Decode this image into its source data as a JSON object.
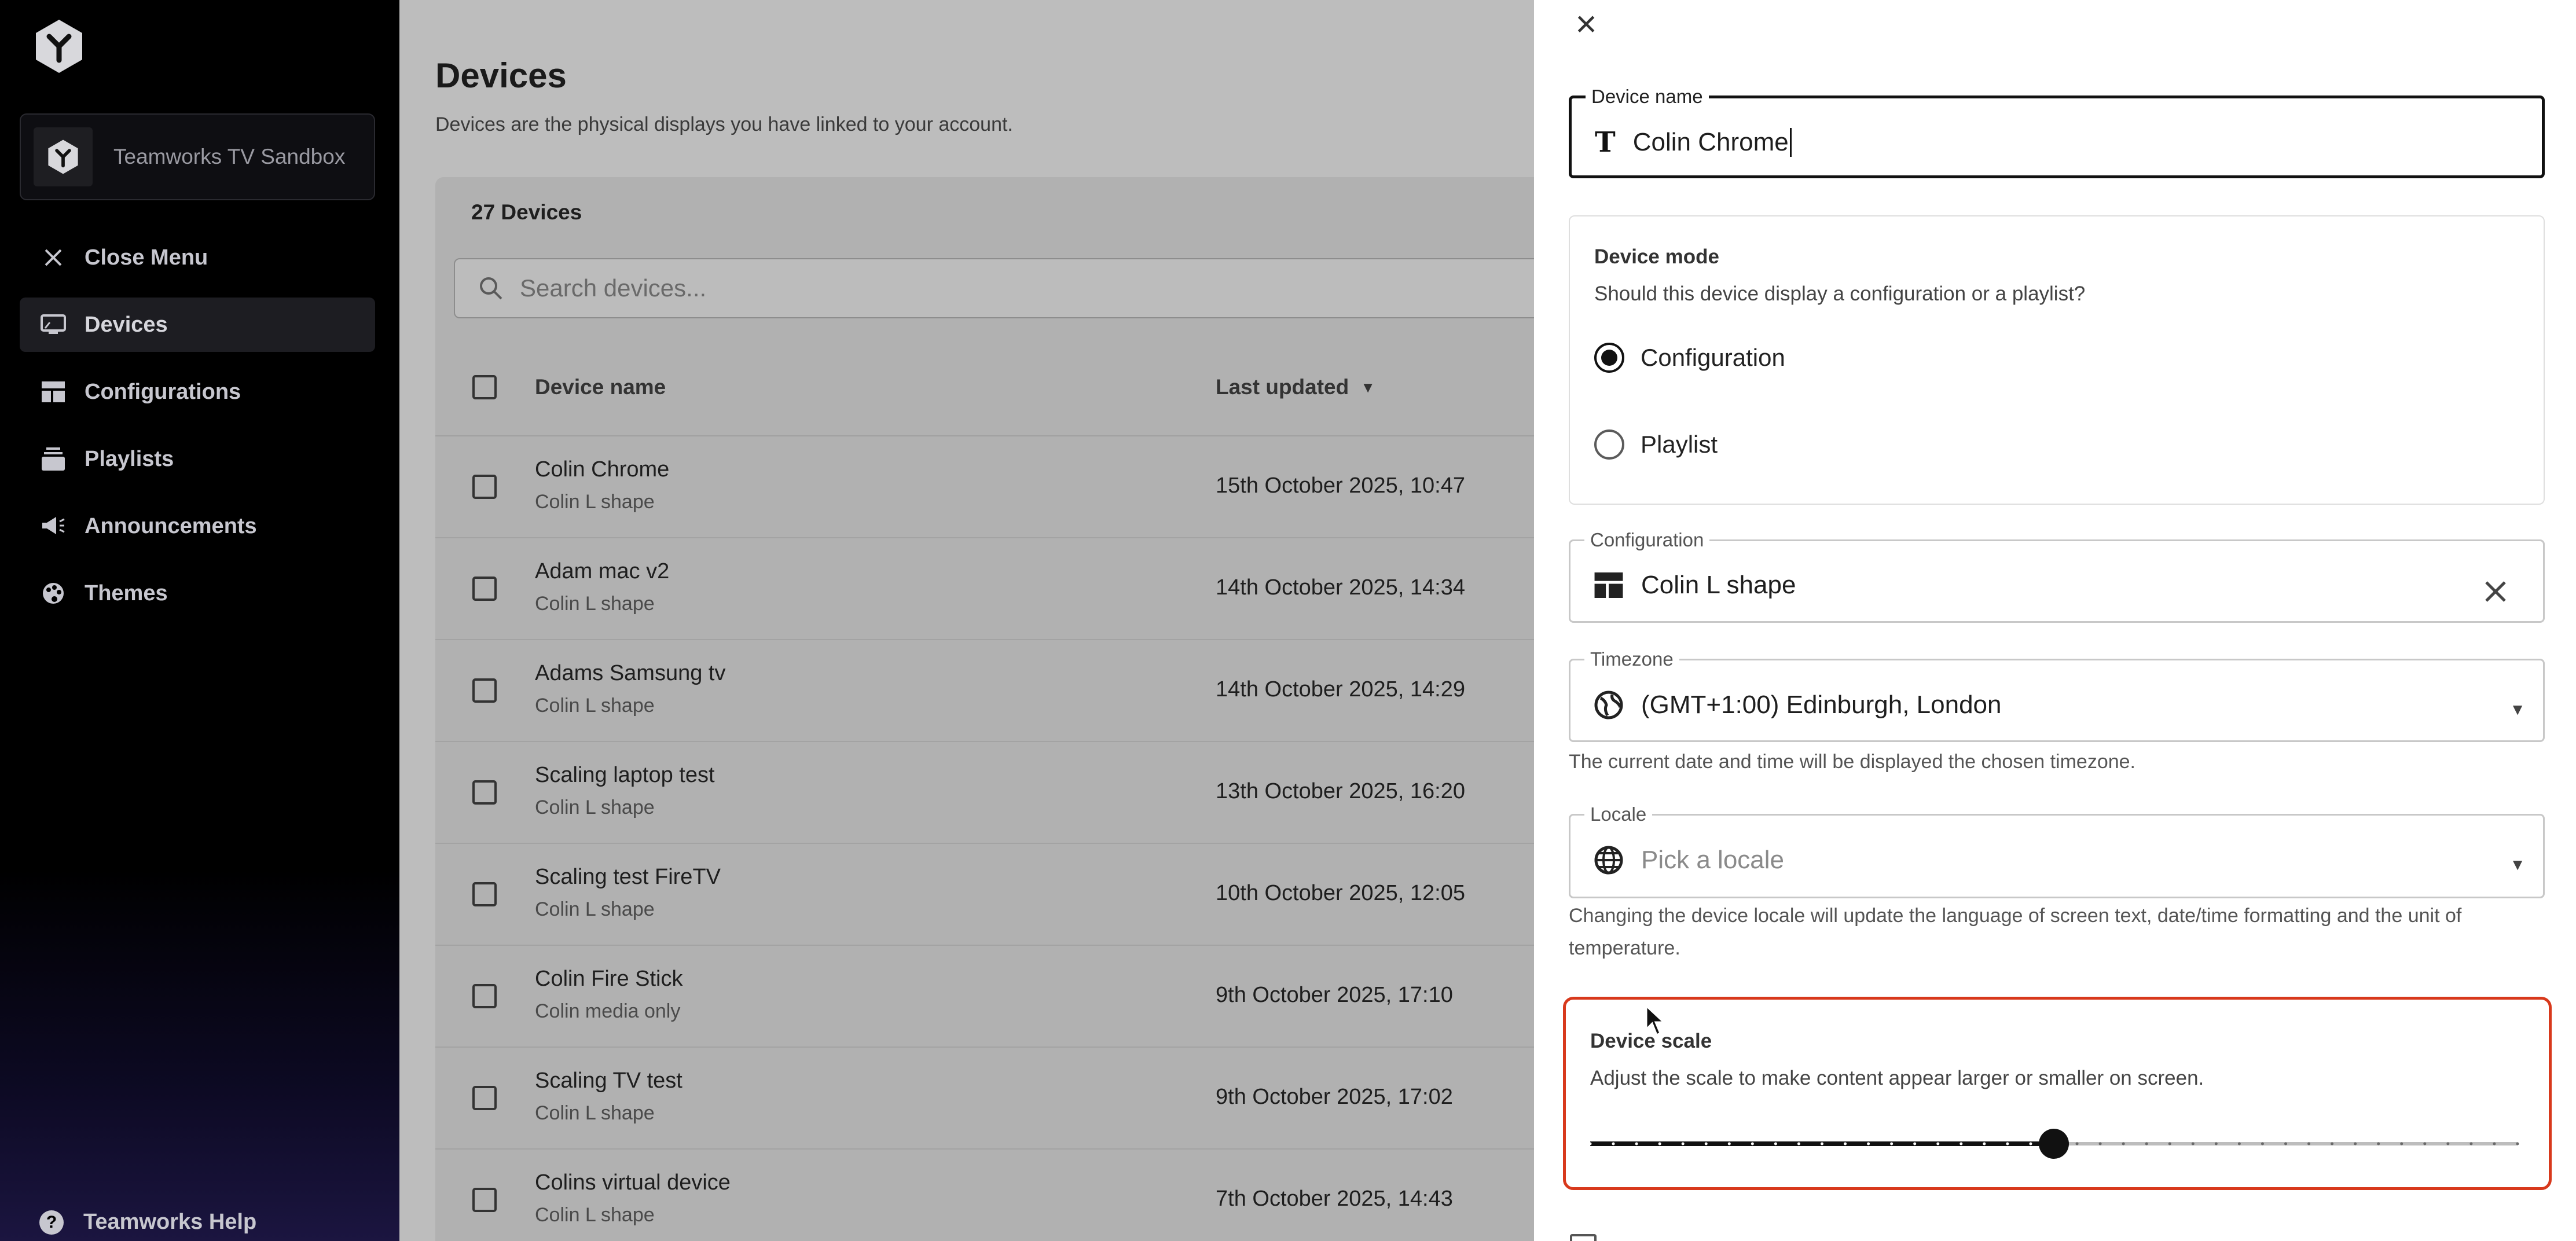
{
  "sidebar": {
    "org_name": "Teamworks TV Sandbox",
    "items": [
      {
        "label": "Close Menu",
        "icon": "close-icon"
      },
      {
        "label": "Devices",
        "icon": "monitor-icon",
        "active": true
      },
      {
        "label": "Configurations",
        "icon": "layout-icon"
      },
      {
        "label": "Playlists",
        "icon": "playlist-icon"
      },
      {
        "label": "Announcements",
        "icon": "megaphone-icon"
      },
      {
        "label": "Themes",
        "icon": "palette-icon"
      }
    ],
    "help_label": "Teamworks Help"
  },
  "main": {
    "title": "Devices",
    "subtitle": "Devices are the physical displays you have linked to your account.",
    "count_label": "27 Devices",
    "search_placeholder": "Search devices...",
    "columns": {
      "name": "Device name",
      "updated": "Last updated"
    },
    "rows": [
      {
        "name": "Colin Chrome",
        "sub": "Colin L shape",
        "date": "15th October 2025, 10:47"
      },
      {
        "name": "Adam mac v2",
        "sub": "Colin L shape",
        "date": "14th October 2025, 14:34"
      },
      {
        "name": "Adams Samsung tv",
        "sub": "Colin L shape",
        "date": "14th October 2025, 14:29"
      },
      {
        "name": "Scaling laptop test",
        "sub": "Colin L shape",
        "date": "13th October 2025, 16:20"
      },
      {
        "name": "Scaling test FireTV",
        "sub": "Colin L shape",
        "date": "10th October 2025, 12:05"
      },
      {
        "name": "Colin Fire Stick",
        "sub": "Colin media only",
        "date": "9th October 2025, 17:10"
      },
      {
        "name": "Scaling TV test",
        "sub": "Colin L shape",
        "date": "9th October 2025, 17:02"
      },
      {
        "name": "Colins virtual device",
        "sub": "Colin L shape",
        "date": "7th October 2025, 14:43"
      }
    ]
  },
  "panel": {
    "device_name_label": "Device name",
    "device_name_value": "Colin Chrome",
    "mode": {
      "title": "Device mode",
      "description": "Should this device display a configuration or a playlist?",
      "options": [
        {
          "label": "Configuration",
          "checked": true
        },
        {
          "label": "Playlist",
          "checked": false
        }
      ]
    },
    "configuration": {
      "label": "Configuration",
      "value": "Colin L shape"
    },
    "timezone": {
      "label": "Timezone",
      "value": "(GMT+1:00) Edinburgh, London",
      "helper": "The current date and time will be displayed the chosen timezone."
    },
    "locale": {
      "label": "Locale",
      "placeholder": "Pick a locale",
      "helper": "Changing the device locale will update the language of screen text, date/time formatting and the unit of temperature."
    },
    "scale": {
      "title": "Device scale",
      "description": "Adjust the scale to make content appear larger or smaller on screen.",
      "value_fraction": 0.5,
      "steps": 40
    }
  },
  "colors": {
    "sidebar_bg": "#000000",
    "highlight_border": "#d8391c",
    "overlay": "#bdbdbd"
  }
}
